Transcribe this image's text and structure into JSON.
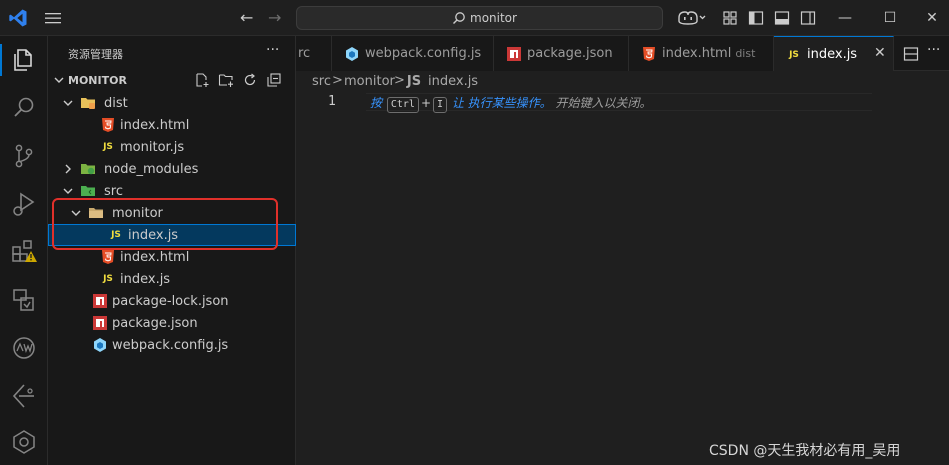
{
  "titlebar": {
    "search_text": "monitor",
    "window_controls": [
      "—",
      "☐",
      "✕"
    ]
  },
  "sidebar": {
    "title": "资源管理器",
    "more": "···",
    "section_title": "MONITOR",
    "tree": [
      {
        "label": "dist",
        "kind": "folder-dist",
        "depth": 1,
        "expanded": true
      },
      {
        "label": "index.html",
        "kind": "html",
        "depth": 2
      },
      {
        "label": "monitor.js",
        "kind": "js",
        "depth": 2
      },
      {
        "label": "node_modules",
        "kind": "folder-node",
        "depth": 1,
        "expanded": false
      },
      {
        "label": "src",
        "kind": "folder-src",
        "depth": 1,
        "expanded": true
      },
      {
        "label": "monitor",
        "kind": "folder",
        "depth": 2,
        "expanded": true
      },
      {
        "label": "index.js",
        "kind": "js",
        "depth": 3,
        "selected": true
      },
      {
        "label": "index.html",
        "kind": "html",
        "depth": 2
      },
      {
        "label": "index.js",
        "kind": "js",
        "depth": 2
      },
      {
        "label": "package-lock.json",
        "kind": "npm",
        "depth": 1
      },
      {
        "label": "package.json",
        "kind": "npm",
        "depth": 1
      },
      {
        "label": "webpack.config.js",
        "kind": "webpack",
        "depth": 1
      }
    ]
  },
  "tabs": [
    {
      "label": "rc",
      "kind": "none"
    },
    {
      "label": "webpack.config.js",
      "kind": "webpack"
    },
    {
      "label": "package.json",
      "kind": "npm"
    },
    {
      "label": "index.html",
      "desc": "dist",
      "kind": "html"
    },
    {
      "label": "index.js",
      "kind": "js",
      "active": true,
      "close": "✕"
    }
  ],
  "breadcrumb": {
    "items": [
      "src",
      "monitor",
      "index.js"
    ],
    "separator": ">"
  },
  "editor": {
    "line_number": "1",
    "hint_press": "按",
    "hint_key1": "Ctrl",
    "hint_plus": "+",
    "hint_key2": "I",
    "hint_action": "让 执行某些操作。",
    "hint_rest": "开始键入以关闭。"
  },
  "file_icon_text": {
    "js": "JS"
  },
  "watermark": "CSDN @天生我材必有用_吴用",
  "colors": {
    "accent": "#0078d4",
    "selection_bg": "#04395e",
    "highlight_box": "#e0302a",
    "js_yellow": "#f1dd3f",
    "html_orange": "#e44d26",
    "npm_red": "#cb3837",
    "hint_blue": "#3794ff"
  }
}
